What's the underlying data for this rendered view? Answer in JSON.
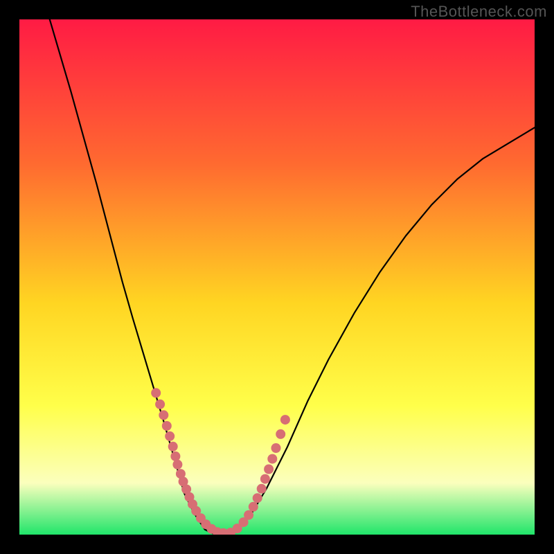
{
  "watermark": "TheBottleneck.com",
  "colors": {
    "frame_bg": "#000000",
    "grad_top": "#ff1b44",
    "grad_upper_mid": "#ff6a30",
    "grad_mid": "#ffd522",
    "grad_lower_mid": "#ffff4a",
    "grad_pale": "#fbffbd",
    "grad_bottom": "#20e56a",
    "curve": "#000000",
    "markers": "#d76e74"
  },
  "chart_data": {
    "type": "line",
    "title": "",
    "xlabel": "",
    "ylabel": "",
    "xlim": [
      0,
      100
    ],
    "ylim": [
      0,
      100
    ],
    "series": [
      {
        "name": "bottleneck-curve",
        "x": [
          0,
          5,
          10,
          15,
          20,
          22,
          25,
          28,
          30,
          32,
          34,
          36,
          38,
          40,
          42,
          45,
          48,
          52,
          56,
          60,
          65,
          70,
          75,
          80,
          85,
          90,
          95,
          100
        ],
        "values": [
          120,
          103,
          86,
          68,
          49,
          42,
          32,
          22,
          15,
          8,
          4,
          1,
          0,
          0,
          1,
          4,
          9,
          17,
          26,
          34,
          43,
          51,
          58,
          64,
          69,
          73,
          76,
          79
        ]
      }
    ],
    "markers": {
      "name": "highlight-points",
      "x": [
        26.5,
        27.3,
        28.0,
        28.6,
        29.2,
        29.8,
        30.3,
        30.7,
        31.3,
        31.8,
        32.4,
        33.0,
        33.6,
        34.3,
        35.2,
        36.2,
        37.3,
        38.4,
        39.6,
        41.0,
        42.3,
        43.5,
        44.5,
        45.4,
        46.2,
        47.0,
        47.7,
        48.4,
        49.1,
        49.8,
        50.7,
        51.6
      ],
      "values": [
        27.5,
        25.3,
        23.2,
        21.1,
        19.1,
        17.1,
        15.2,
        13.6,
        11.8,
        10.3,
        8.8,
        7.3,
        5.9,
        4.6,
        3.2,
        2.0,
        1.1,
        0.5,
        0.3,
        0.4,
        1.2,
        2.4,
        3.8,
        5.4,
        7.1,
        8.9,
        10.8,
        12.7,
        14.7,
        16.8,
        19.5,
        22.3
      ]
    }
  }
}
